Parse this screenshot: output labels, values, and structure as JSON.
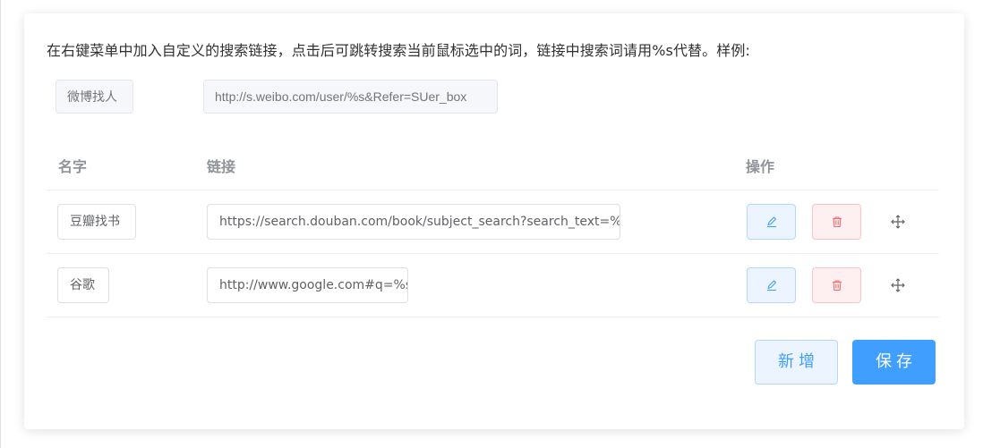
{
  "description": "在右键菜单中加入自定义的搜索链接，点击后可跳转搜索当前鼠标选中的词，链接中搜索词请用%s代替。样例:",
  "example": {
    "name_placeholder": "微博找人",
    "url_placeholder": "http://s.weibo.com/user/%s&Refer=SUer_box"
  },
  "table": {
    "headers": {
      "name": "名字",
      "link": "链接",
      "actions": "操作"
    },
    "rows": [
      {
        "name": "豆瓣找书",
        "url": "https://search.douban.com/book/subject_search?search_text=%s"
      },
      {
        "name": "谷歌",
        "url": "http://www.google.com#q=%s"
      }
    ]
  },
  "buttons": {
    "add": "新增",
    "save": "保存"
  },
  "icons": {
    "edit": "edit-icon",
    "delete": "delete-icon",
    "drag": "drag-move-icon"
  },
  "colors": {
    "primary": "#409eff",
    "danger": "#f56c6c"
  }
}
